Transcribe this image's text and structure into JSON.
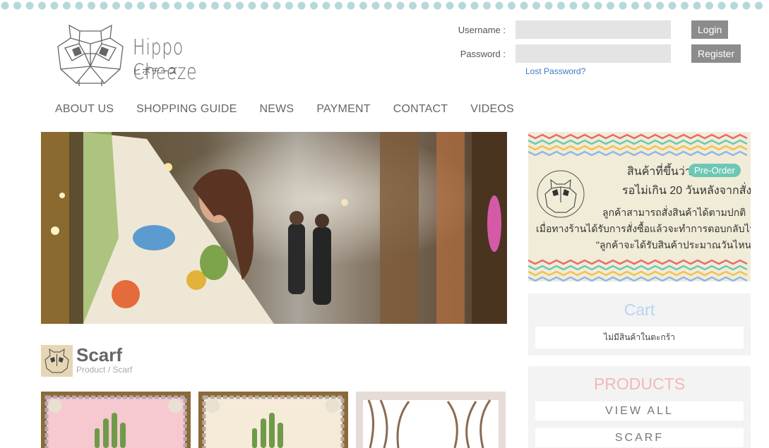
{
  "brand": {
    "name": "Hippo Cheeze",
    "subtitle": "ヒポチーズ"
  },
  "login": {
    "username_label": "Username :",
    "password_label": "Password :",
    "login_button": "Login",
    "register_button": "Register",
    "lost_password": "Lost Password?"
  },
  "nav": {
    "items": [
      "ABOUT US",
      "SHOPPING GUIDE",
      "NEWS",
      "PAYMENT",
      "CONTACT",
      "VIDEOS"
    ]
  },
  "banner": {
    "line1": "สินค้าที่ขึ้นว่า",
    "badge": "Pre-Order",
    "line2": "รอไม่เกิน 20 วันหลังจากสั่ง",
    "line3": "ลูกค้าสามารถสั่งสินค้าได้ตามปกติ",
    "line4": "เมื่อทางร้านได้รับการสั่งซื้อแล้วจะทำการตอบกลับไปว่า",
    "line5": "\"ลูกค้าจะได้รับสินค้าประมาณวันไหนค่ะ\""
  },
  "cart": {
    "title": "Cart",
    "empty_text": "ไม่มีสินค้าในตะกร้า"
  },
  "products_box": {
    "title": "PRODUCTS",
    "items": [
      "VIEW ALL",
      "SCARF"
    ]
  },
  "category": {
    "title": "Scarf",
    "breadcrumb": "Product / Scarf"
  },
  "colors": {
    "dots": "#b7d8da",
    "button": "#8c8c8c",
    "link": "#3d7bc4",
    "cart_title": "#b9d4ef",
    "products_title": "#f2b8b8"
  }
}
